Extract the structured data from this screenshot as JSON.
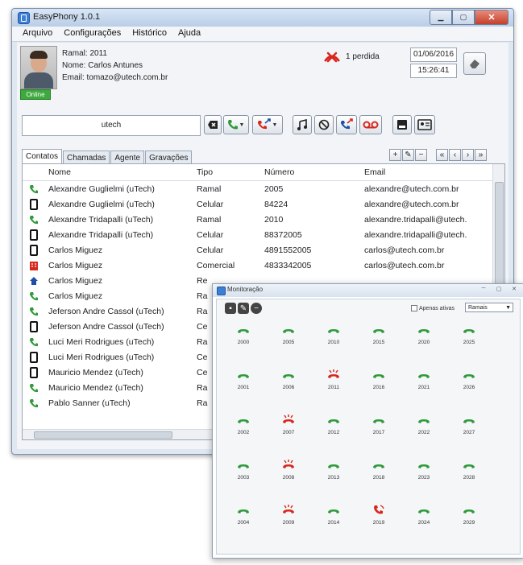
{
  "window": {
    "title": "EasyPhony 1.0.1",
    "menu": [
      "Arquivo",
      "Configurações",
      "Histórico",
      "Ajuda"
    ]
  },
  "user": {
    "ramal": "Ramal: 2011",
    "nome": "Nome: Carlos Antunes",
    "email": "Email: tomazo@utech.com.br",
    "status": "Online"
  },
  "missed": {
    "text": "1 perdida"
  },
  "datetime": {
    "date": "01/06/2016",
    "time": "15:26:41"
  },
  "dialer": {
    "value": "utech"
  },
  "tabs": [
    "Contatos",
    "Chamadas",
    "Agente",
    "Gravações"
  ],
  "mini_buttons": [
    "+",
    "✎",
    "−",
    "«",
    "‹",
    "›",
    "»"
  ],
  "table": {
    "headers": [
      "Nome",
      "Tipo",
      "Número",
      "Email"
    ],
    "rows": [
      {
        "icon": "ramal",
        "nome": "Alexandre Guglielmi (uTech)",
        "tipo": "Ramal",
        "numero": "2005",
        "email": "alexandre@utech.com.br"
      },
      {
        "icon": "celular",
        "nome": "Alexandre Guglielmi (uTech)",
        "tipo": "Celular",
        "numero": "84224",
        "email": "alexandre@utech.com.br"
      },
      {
        "icon": "ramal",
        "nome": "Alexandre Tridapalli (uTech)",
        "tipo": "Ramal",
        "numero": "2010",
        "email": "alexandre.tridapalli@utech."
      },
      {
        "icon": "celular",
        "nome": "Alexandre Tridapalli (uTech)",
        "tipo": "Celular",
        "numero": "88372005",
        "email": "alexandre.tridapalli@utech."
      },
      {
        "icon": "celular",
        "nome": "Carlos Miguez",
        "tipo": "Celular",
        "numero": "4891552005",
        "email": "carlos@utech.com.br"
      },
      {
        "icon": "comercial",
        "nome": "Carlos Miguez",
        "tipo": "Comercial",
        "numero": "4833342005",
        "email": "carlos@utech.com.br"
      },
      {
        "icon": "residencial",
        "nome": "Carlos Miguez",
        "tipo": "Re",
        "numero": "",
        "email": ""
      },
      {
        "icon": "ramal",
        "nome": "Carlos Miguez",
        "tipo": "Ra",
        "numero": "",
        "email": ""
      },
      {
        "icon": "ramal",
        "nome": "Jeferson Andre Cassol (uTech)",
        "tipo": "Ra",
        "numero": "",
        "email": ""
      },
      {
        "icon": "celular",
        "nome": "Jeferson Andre Cassol (uTech)",
        "tipo": "Ce",
        "numero": "",
        "email": ""
      },
      {
        "icon": "ramal",
        "nome": "Luci Meri Rodrigues (uTech)",
        "tipo": "Ra",
        "numero": "",
        "email": ""
      },
      {
        "icon": "celular",
        "nome": "Luci Meri Rodrigues (uTech)",
        "tipo": "Ce",
        "numero": "",
        "email": ""
      },
      {
        "icon": "celular",
        "nome": "Mauricio Mendez (uTech)",
        "tipo": "Ce",
        "numero": "",
        "email": ""
      },
      {
        "icon": "ramal",
        "nome": "Mauricio Mendez (uTech)",
        "tipo": "Ra",
        "numero": "",
        "email": ""
      },
      {
        "icon": "ramal",
        "nome": "Pablo Sanner (uTech)",
        "tipo": "Ra",
        "numero": "",
        "email": ""
      }
    ]
  },
  "monitor": {
    "title": "Monitoração",
    "only_active_label": "Apenas ativas",
    "select_value": "Ramais",
    "columns": [
      [
        {
          "ext": "2000",
          "state": "idle"
        },
        {
          "ext": "2001",
          "state": "idle"
        },
        {
          "ext": "2002",
          "state": "idle"
        },
        {
          "ext": "2003",
          "state": "idle"
        },
        {
          "ext": "2004",
          "state": "idle"
        }
      ],
      [
        {
          "ext": "2005",
          "state": "idle"
        },
        {
          "ext": "2006",
          "state": "idle"
        },
        {
          "ext": "2007",
          "state": "busy"
        },
        {
          "ext": "2008",
          "state": "busy"
        },
        {
          "ext": "2009",
          "state": "busy"
        }
      ],
      [
        {
          "ext": "2010",
          "state": "idle"
        },
        {
          "ext": "2011",
          "state": "busy"
        },
        {
          "ext": "2012",
          "state": "idle"
        },
        {
          "ext": "2013",
          "state": "idle"
        },
        {
          "ext": "2014",
          "state": "idle"
        }
      ],
      [
        {
          "ext": "2015",
          "state": "idle"
        },
        {
          "ext": "2016",
          "state": "idle"
        },
        {
          "ext": "2017",
          "state": "idle"
        },
        {
          "ext": "2018",
          "state": "idle"
        },
        {
          "ext": "2019",
          "state": "ringing"
        }
      ],
      [
        {
          "ext": "2020",
          "state": "idle"
        },
        {
          "ext": "2021",
          "state": "idle"
        },
        {
          "ext": "2022",
          "state": "idle"
        },
        {
          "ext": "2023",
          "state": "idle"
        },
        {
          "ext": "2024",
          "state": "idle"
        }
      ],
      [
        {
          "ext": "2025",
          "state": "idle"
        },
        {
          "ext": "2026",
          "state": "idle"
        },
        {
          "ext": "2027",
          "state": "idle"
        },
        {
          "ext": "2028",
          "state": "idle"
        },
        {
          "ext": "2029",
          "state": "idle"
        }
      ]
    ]
  },
  "colors": {
    "idle": "#2f9a3a",
    "busy": "#d8281e",
    "accent": "#3c7fd6"
  }
}
